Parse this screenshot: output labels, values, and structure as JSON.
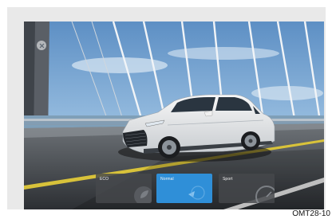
{
  "drive_modes": {
    "eco_label": "ECO",
    "normal_label": "Normal",
    "sport_label": "Sport",
    "selected": "Normal"
  },
  "caption": "OMT28-10",
  "colors": {
    "accent": "#2f8fd8",
    "inactive_button": "#46484c",
    "frame": "#e9e9e9"
  },
  "icons": {
    "close": "close-icon",
    "eco": "leaf-icon",
    "normal": "gauge-icon",
    "sport": "speedometer-icon"
  }
}
